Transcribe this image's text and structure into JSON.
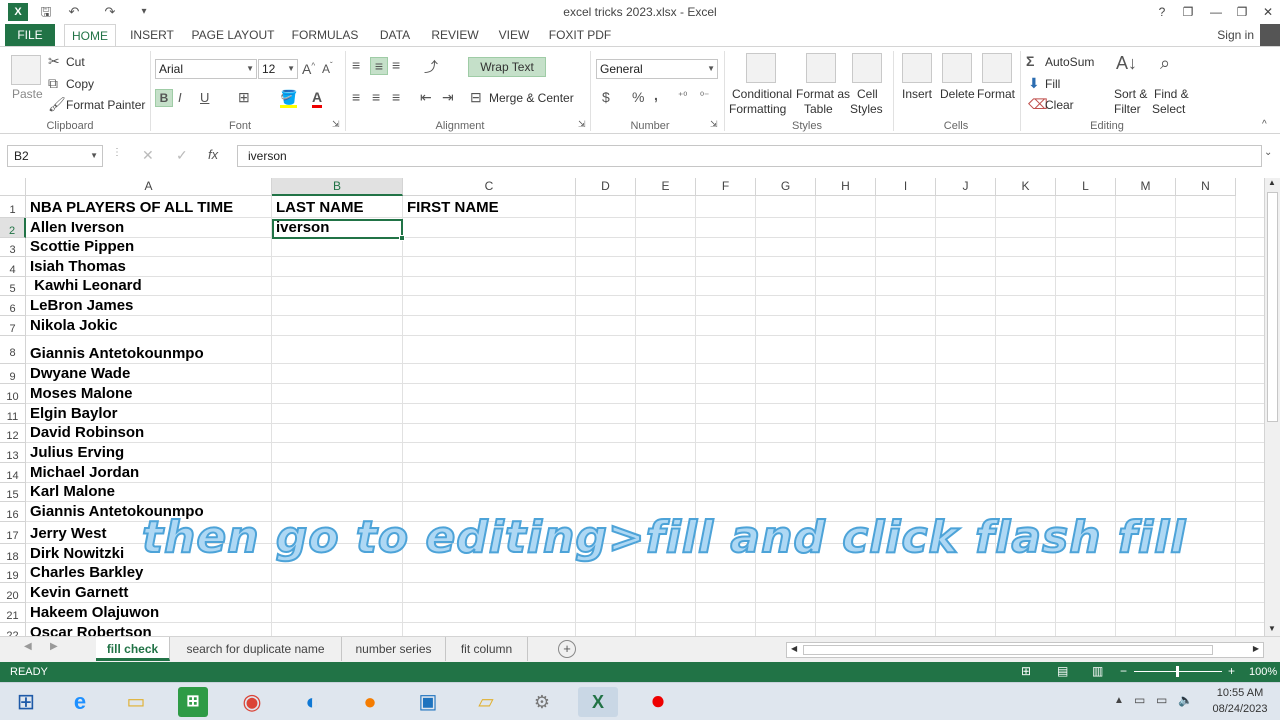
{
  "window": {
    "title": "excel tricks 2023.xlsx - Excel",
    "help": "?",
    "restore": "❐",
    "minimize": "—",
    "maximize": "❐",
    "close": "✕"
  },
  "tabs": [
    "FILE",
    "HOME",
    "INSERT",
    "PAGE LAYOUT",
    "FORMULAS",
    "DATA",
    "REVIEW",
    "VIEW",
    "FOXIT PDF"
  ],
  "signin": "Sign in",
  "ribbon": {
    "clipboard": {
      "paste": "Paste",
      "cut": "Cut",
      "copy": "Copy",
      "format_painter": "Format Painter",
      "label": "Clipboard"
    },
    "font": {
      "name": "Arial",
      "size": "12",
      "bold": "B",
      "italic": "I",
      "underline": "U",
      "label": "Font"
    },
    "alignment": {
      "wrap_text": "Wrap Text",
      "merge_center": "Merge & Center",
      "label": "Alignment"
    },
    "number": {
      "format": "General",
      "currency": "$",
      "percent": "%",
      "comma": ",",
      "label": "Number"
    },
    "styles": {
      "conditional": "Conditional",
      "formatting": "Formatting",
      "format_as": "Format as",
      "table": "Table",
      "cell": "Cell",
      "cell_styles": "Styles",
      "label": "Styles"
    },
    "cells": {
      "insert": "Insert",
      "delete": "Delete",
      "format": "Format",
      "label": "Cells"
    },
    "editing": {
      "autosum": "AutoSum",
      "fill": "Fill",
      "clear": "Clear",
      "sort": "Sort &",
      "filter": "Filter",
      "find": "Find &",
      "select": "Select",
      "label": "Editing"
    }
  },
  "formula_bar": {
    "name_box": "B2",
    "fx": "fx",
    "value": "iverson"
  },
  "columns": [
    "A",
    "B",
    "C",
    "D",
    "E",
    "F",
    "G",
    "H",
    "I",
    "J",
    "K",
    "L",
    "M",
    "N"
  ],
  "rows": [
    "1",
    "2",
    "3",
    "4",
    "5",
    "6",
    "7",
    "8",
    "9",
    "10",
    "11",
    "12",
    "13",
    "14",
    "15",
    "16",
    "17",
    "18",
    "19",
    "20",
    "21",
    "22"
  ],
  "cells": {
    "a1": "NBA PLAYERS OF ALL TIME",
    "b1": "LAST NAME",
    "c1": "FIRST NAME",
    "b2": "iverson",
    "players": [
      "Allen Iverson",
      "Scottie Pippen",
      "Isiah Thomas",
      " Kawhi Leonard",
      "LeBron James",
      "Nikola Jokic",
      "Giannis Antetokounmpo",
      "Dwyane Wade",
      "Moses Malone",
      "Elgin Baylor",
      "David Robinson",
      "Julius Erving",
      "Michael Jordan",
      "Karl Malone",
      "Giannis Antetokounmpo",
      "Jerry West",
      "Dirk Nowitzki",
      "Charles Barkley",
      "Kevin Garnett",
      "Hakeem Olajuwon",
      "Oscar Robertson"
    ]
  },
  "sheet_tabs": [
    "fill check",
    "search for duplicate name",
    "number series",
    "fit column"
  ],
  "status": {
    "ready": "READY",
    "zoom": "100%"
  },
  "caption": "then go to editing>fill and click flash fill",
  "clock": {
    "time": "10:55 AM",
    "date": "08/24/2023"
  }
}
